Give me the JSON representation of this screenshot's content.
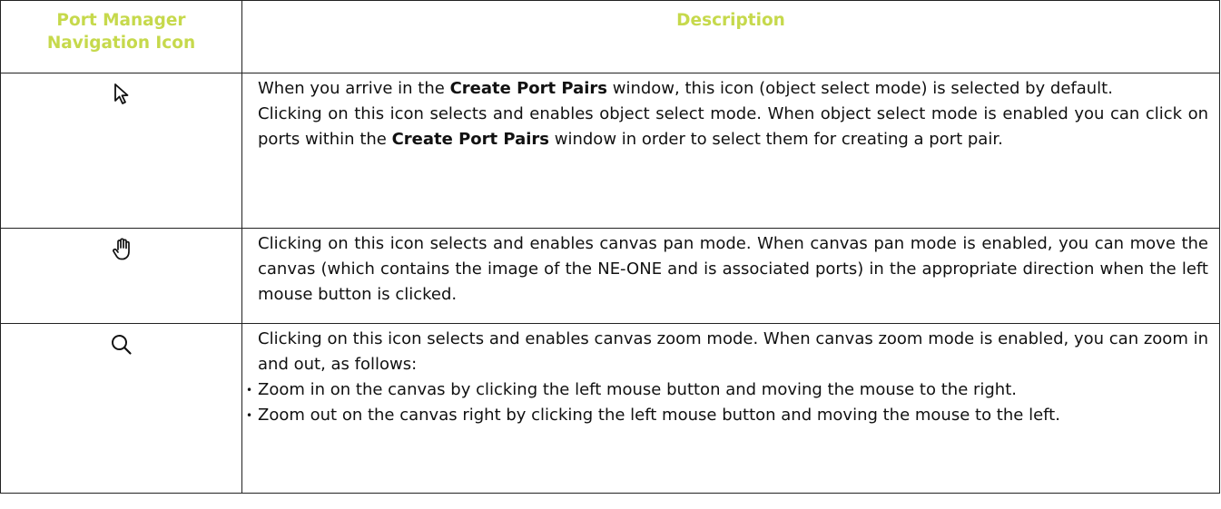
{
  "headers": {
    "icon_col": "Port Manager Navigation Icon",
    "desc_col": "Description"
  },
  "colors": {
    "header_text": "#c6d94c",
    "border": "#222222"
  },
  "rows": [
    {
      "icon": "pointer-arrow-icon",
      "p1_a": "When you arrive in the ",
      "p1_b": "Create Port Pairs",
      "p1_c": " window, this icon (object select mode) is selected by default.",
      "p2_a": "Clicking on this icon selects and enables object select mode. When object select mode is enabled you can click on ports within the ",
      "p2_b": "Create Port Pairs",
      "p2_c": " window in order to select them for creating a port pair."
    },
    {
      "icon": "hand-pan-icon",
      "p1": "Clicking on this icon selects and enables canvas pan mode. When canvas pan mode is enabled, you can move the canvas (which contains the image of the NE-ONE and is associated ports) in the appropriate direction when the left mouse button is clicked."
    },
    {
      "icon": "magnifier-zoom-icon",
      "p1": "Clicking on this icon selects and enables canvas zoom mode. When canvas zoom mode is enabled, you can zoom in and out, as follows:",
      "bullets": [
        "Zoom in on the canvas by clicking the left mouse button and moving the mouse to the right.",
        "Zoom out on the canvas right by clicking the left mouse button and moving the mouse to the left."
      ]
    }
  ]
}
